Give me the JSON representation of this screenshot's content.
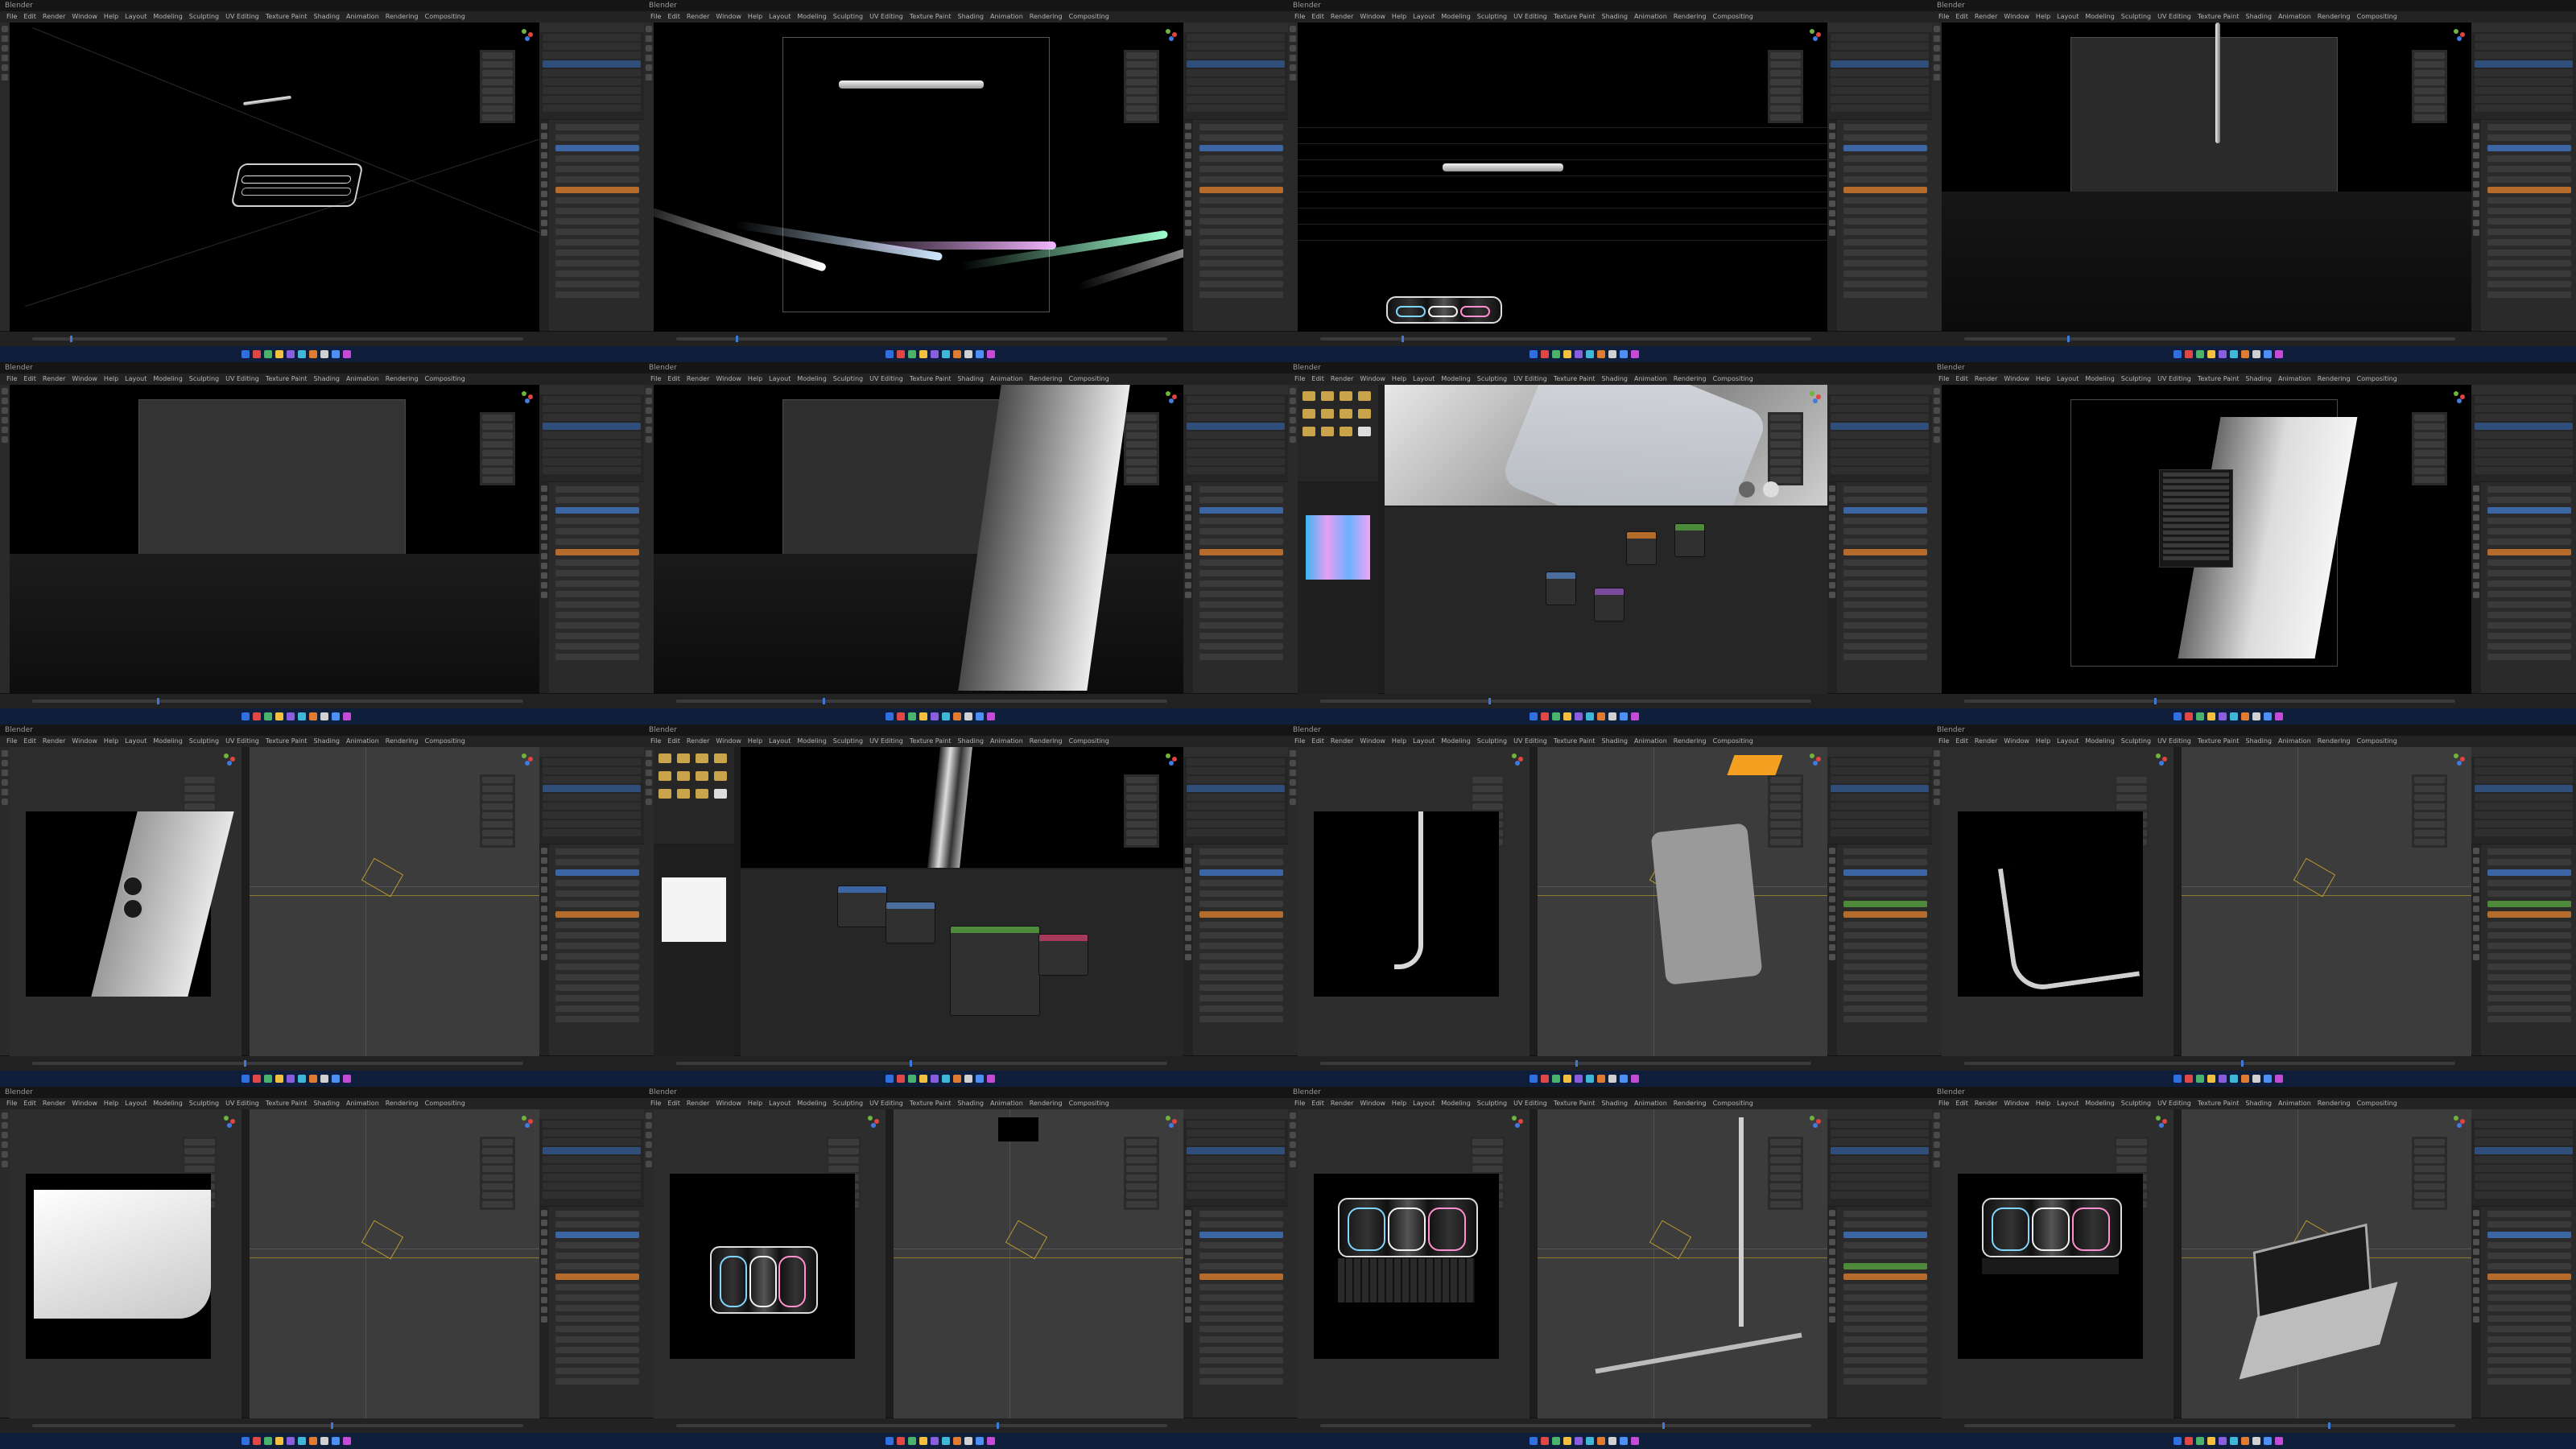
{
  "app": {
    "window_title": "Blender",
    "menu": [
      "File",
      "Edit",
      "Render",
      "Window",
      "Help",
      "Layout",
      "Modeling",
      "Sculpting",
      "UV Editing",
      "Texture Paint",
      "Shading",
      "Animation",
      "Rendering",
      "Compositing"
    ]
  },
  "cells": [
    {
      "id": 1,
      "layout": "single",
      "viewport": "User Perspective",
      "scene": "tray-with-pencil"
    },
    {
      "id": 2,
      "layout": "single",
      "viewport": "Camera Perspective",
      "scene": "pencil-light-streaks"
    },
    {
      "id": 3,
      "layout": "single",
      "viewport": "Camera Perspective",
      "scene": "pencil-floor"
    },
    {
      "id": 4,
      "layout": "single",
      "viewport": "Camera Perspective",
      "scene": "vertical-pencil"
    },
    {
      "id": 5,
      "layout": "single",
      "viewport": "Camera Perspective",
      "scene": "empty-stage"
    },
    {
      "id": 6,
      "layout": "single",
      "viewport": "Camera Perspective",
      "scene": "tablet-edge-grey"
    },
    {
      "id": 7,
      "layout": "shading",
      "viewport": "Material Preview",
      "scene": "tablet-material-preview"
    },
    {
      "id": 8,
      "layout": "single",
      "viewport": "Camera Perspective",
      "scene": "tablet-context-menu"
    },
    {
      "id": 9,
      "layout": "split",
      "viewport": "Camera Perspective",
      "scene": "tablet-camera-bump"
    },
    {
      "id": 10,
      "layout": "shading",
      "viewport": "Camera Perspective",
      "scene": "tablet-edge-nodes"
    },
    {
      "id": 11,
      "layout": "split",
      "viewport": "Camera Perspective",
      "scene": "tablet-corner-and-back"
    },
    {
      "id": 12,
      "layout": "split",
      "viewport": "Camera Perspective",
      "scene": "tablet-corner-rim"
    },
    {
      "id": 13,
      "layout": "split",
      "viewport": "Camera Perspective",
      "scene": "tablet-corner-white"
    },
    {
      "id": 14,
      "layout": "split",
      "viewport": "Camera Perspective",
      "scene": "tray-square"
    },
    {
      "id": 15,
      "layout": "split",
      "viewport": "Camera Perspective",
      "scene": "tray-keyboard"
    },
    {
      "id": 16,
      "layout": "split",
      "viewport": "Camera Perspective",
      "scene": "tray-keyboard-laptop"
    }
  ],
  "colors": {
    "ui_dark": "#1d1d1d",
    "panel": "#2a2a2a",
    "selection_blue": "#3c66a3",
    "active_orange": "#f5a020",
    "node_green": "#4d8b3b",
    "taskbar": "#0f1e3a"
  },
  "icons": [
    "blender-logo-icon",
    "cursor-icon",
    "move-icon",
    "rotate-icon",
    "scale-icon",
    "camera-icon",
    "light-icon",
    "folder-icon",
    "image-icon"
  ]
}
